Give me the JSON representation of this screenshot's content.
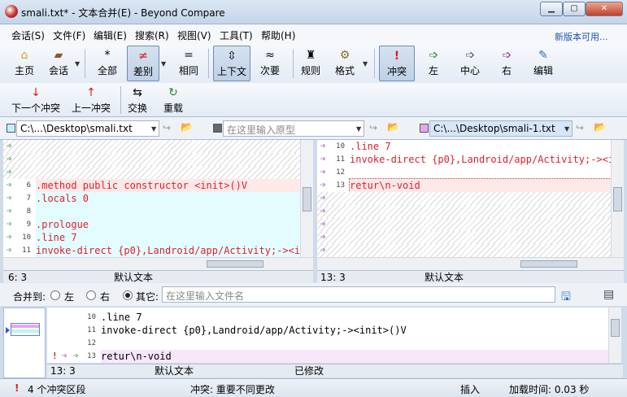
{
  "window": {
    "title": "smali.txt* - 文本合并(E) - Beyond Compare",
    "min": "▁",
    "max": "▢",
    "close": "✕"
  },
  "menu": [
    "会话(S)",
    "文件(F)",
    "编辑(E)",
    "搜索(R)",
    "视图(V)",
    "工具(T)",
    "帮助(H)"
  ],
  "new_version": "新版本可用...",
  "toolbar": {
    "home": "主页",
    "sessions": "会话",
    "all": "全部",
    "diffs": "差别",
    "same": "相同",
    "context": "上下文",
    "minor": "次要",
    "rules": "规则",
    "format": "格式",
    "conflicts": "冲突",
    "left": "左",
    "center": "中心",
    "right": "右",
    "edit": "编辑"
  },
  "toolbar2": {
    "next_conflict": "下一个冲突",
    "prev_conflict": "上一冲突",
    "swap": "交换",
    "reload": "重载"
  },
  "paths": {
    "left": "C:\\...\\Desktop\\smali.txt",
    "center_placeholder": "在这里输入原型",
    "right": "C:\\...\\Desktop\\smali-1.txt"
  },
  "left_pane": {
    "lines": [
      {
        "num": "",
        "text": "",
        "kind": "hatch"
      },
      {
        "num": "",
        "text": "",
        "kind": "hatch"
      },
      {
        "num": "",
        "text": "",
        "kind": "hatch"
      },
      {
        "num": "6",
        "text": ".method public constructor <init>()V",
        "kind": "red"
      },
      {
        "num": "7",
        "text": ".locals 0",
        "kind": "cyan"
      },
      {
        "num": "8",
        "text": "",
        "kind": "cyan"
      },
      {
        "num": "9",
        "text": ".prologue",
        "kind": "cyan"
      },
      {
        "num": "10",
        "text": ".line 7",
        "kind": "cyan"
      },
      {
        "num": "11",
        "text": "invoke-direct {p0},Landroid/app/Activity;-><in",
        "kind": "cyan"
      },
      {
        "num": "12",
        "text": "",
        "kind": "cyan"
      }
    ],
    "status_pos": "6: 3",
    "status_enc": "默认文本"
  },
  "right_pane": {
    "lines": [
      {
        "num": "10",
        "text": ".line 7",
        "kind": "normal"
      },
      {
        "num": "11",
        "text": "invoke-direct {p0},Landroid/app/Activity;-><in",
        "kind": "normal"
      },
      {
        "num": "12",
        "text": "",
        "kind": "normal"
      },
      {
        "num": "13",
        "text": "retur\\n-void",
        "kind": "selected"
      },
      {
        "num": "",
        "text": "",
        "kind": "hatch"
      },
      {
        "num": "",
        "text": "",
        "kind": "hatch"
      },
      {
        "num": "",
        "text": "",
        "kind": "hatch"
      },
      {
        "num": "",
        "text": "",
        "kind": "hatch"
      },
      {
        "num": "",
        "text": "",
        "kind": "hatch"
      },
      {
        "num": "",
        "text": "",
        "kind": "hatch"
      }
    ],
    "status_pos": "13: 3",
    "status_enc": "默认文本"
  },
  "merge": {
    "label": "合并到:",
    "opt_left": "左",
    "opt_right": "右",
    "opt_other": "其它:",
    "filename_placeholder": "在这里输入文件名",
    "selected": "other"
  },
  "output_pane": {
    "lines": [
      {
        "num": "10",
        "text": ".line 7"
      },
      {
        "num": "11",
        "text": "invoke-direct {p0},Landroid/app/Activity;-><init>()V"
      },
      {
        "num": "12",
        "text": ""
      },
      {
        "num": "13",
        "text": "retur\\n-void"
      }
    ],
    "status_pos": "13: 3",
    "status_enc": "默认文本",
    "status_mod": "已修改"
  },
  "bottom_status": {
    "conflicts": "4 个冲突区段",
    "conflict_desc": "冲突: 重要不同更改",
    "mode": "插入",
    "load_time": "加载时间: 0.03 秒"
  },
  "colors": {
    "diff_red": "#e0202e",
    "red_bg": "#ffe8e8",
    "cyan_bg": "#e2fcff",
    "pink_bg": "#f8e6fb"
  }
}
